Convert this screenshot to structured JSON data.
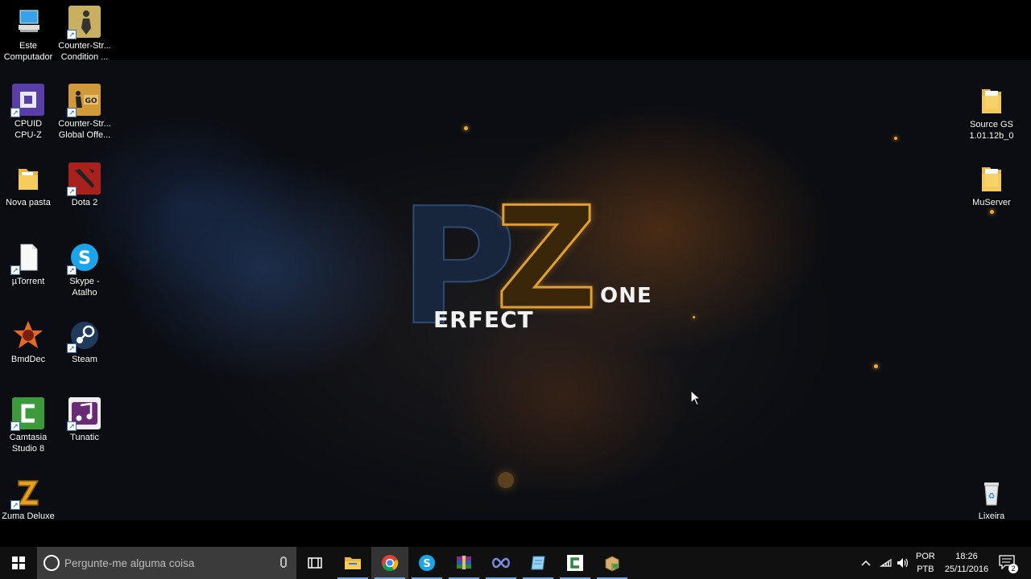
{
  "desktop_icons_left": [
    {
      "name": "este-computador",
      "label": "Este\nComputador",
      "icon": "computer-icon"
    },
    {
      "name": "counter-strike-condition-zero",
      "label": "Counter-Str...\nCondition ...",
      "icon": "counter-strike-icon"
    },
    {
      "name": "cpuid-cpu-z",
      "label": "CPUID\nCPU-Z",
      "icon": "cpu-z-icon"
    },
    {
      "name": "counter-strike-global-offensive",
      "label": "Counter-Str...\nGlobal Offe...",
      "icon": "csgo-icon"
    },
    {
      "name": "nova-pasta",
      "label": "Nova pasta",
      "icon": "folder-icon"
    },
    {
      "name": "dota-2",
      "label": "Dota 2",
      "icon": "dota2-icon"
    },
    {
      "name": "utorrent",
      "label": "µTorrent",
      "icon": "file-icon"
    },
    {
      "name": "skype-atalho",
      "label": "Skype -\nAtalho",
      "icon": "skype-icon"
    },
    {
      "name": "bmddec",
      "label": "BmdDec",
      "icon": "bmddec-icon"
    },
    {
      "name": "steam",
      "label": "Steam",
      "icon": "steam-icon"
    },
    {
      "name": "camtasia-studio-8",
      "label": "Camtasia\nStudio 8",
      "icon": "camtasia-icon"
    },
    {
      "name": "tunatic",
      "label": "Tunatic",
      "icon": "tunatic-icon"
    },
    {
      "name": "zuma-deluxe",
      "label": "Zuma Deluxe",
      "icon": "zuma-icon"
    }
  ],
  "desktop_icons_right": [
    {
      "name": "source-gs",
      "label": "Source GS\n1.01.12b_0",
      "icon": "folder-icon"
    },
    {
      "name": "muserver",
      "label": "MuServer",
      "icon": "folder-icon"
    },
    {
      "name": "lixeira",
      "label": "Lixeira",
      "icon": "recycle-bin-icon"
    }
  ],
  "wallpaper": {
    "logo_erfect": "ERFECT",
    "logo_one": "ONE"
  },
  "taskbar": {
    "search_placeholder": "Pergunte-me alguma coisa",
    "apps": [
      "file-explorer-icon",
      "chrome-icon",
      "skype-icon",
      "winrar-icon",
      "infinity-icon",
      "notepad-icon",
      "camtasia-icon",
      "package-icon"
    ],
    "language_top": "POR",
    "language_bottom": "PTB",
    "time": "18:26",
    "date": "25/11/2016",
    "notifications_count": "2"
  },
  "colors": {
    "taskbar_bg": "#101010",
    "search_bg": "#3b3b3b",
    "logo_gold": "#e0a030",
    "logo_blue": "#2d4a73"
  }
}
